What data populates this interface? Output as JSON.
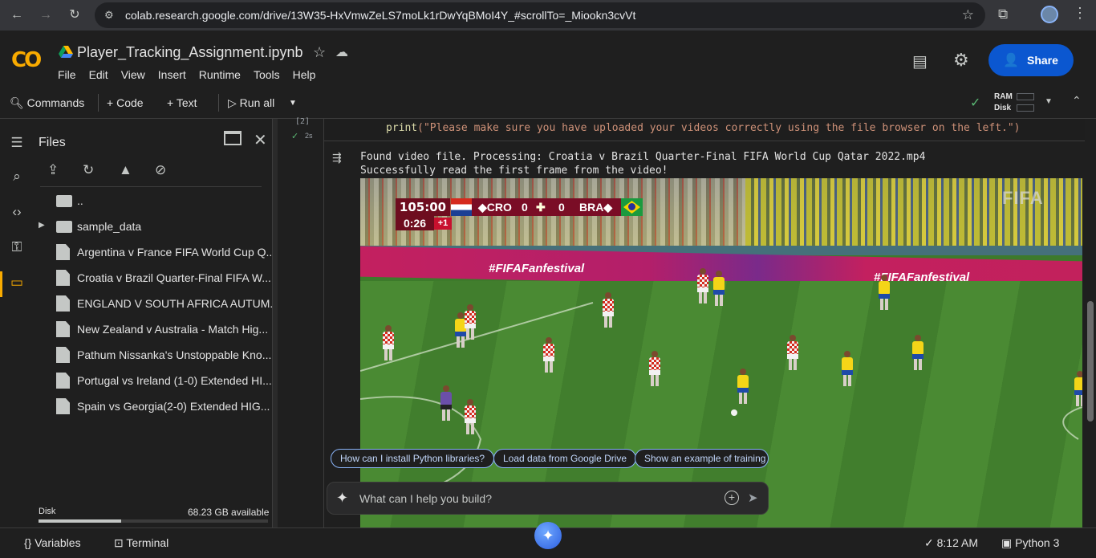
{
  "browser": {
    "url": "colab.research.google.com/drive/13W35-HxVmwZeLS7moLk1rDwYqBMoI4Y_#scrollTo=_Miookn3cvVt"
  },
  "header": {
    "logo": "CO",
    "notebook_title": "Player_Tracking_Assignment.ipynb",
    "menu": [
      "File",
      "Edit",
      "View",
      "Insert",
      "Runtime",
      "Tools",
      "Help"
    ],
    "share_label": "Share"
  },
  "toolbar": {
    "commands": "Commands",
    "code": "Code",
    "text": "Text",
    "run_all": "Run all",
    "ram_label": "RAM",
    "disk_label": "Disk"
  },
  "files_panel": {
    "title": "Files",
    "items": [
      {
        "name": "..",
        "kind": "folder"
      },
      {
        "name": "sample_data",
        "kind": "folder"
      },
      {
        "name": "Argentina v France FIFA World Cup Q...",
        "kind": "file"
      },
      {
        "name": "Croatia v Brazil Quarter-Final FIFA W...",
        "kind": "file"
      },
      {
        "name": "ENGLAND V SOUTH AFRICA AUTUM...",
        "kind": "file"
      },
      {
        "name": "New Zealand v Australia - Match Hig...",
        "kind": "file"
      },
      {
        "name": "Pathum Nissanka's Unstoppable Kno...",
        "kind": "file"
      },
      {
        "name": "Portugal vs Ireland (1-0) Extended HI...",
        "kind": "file"
      },
      {
        "name": "Spain vs Georgia(2-0) Extended HIG...",
        "kind": "file"
      }
    ],
    "disk_label": "Disk",
    "disk_available": "68.23 GB available",
    "disk_used_fraction": 0.36
  },
  "cell": {
    "exec_count": "[2]",
    "duration": "2s",
    "code_print": "print",
    "code_string": "(\"Please make sure you have uploaded your videos correctly using the file browser on the left.\")",
    "output_lines": [
      "Found video file. Processing: Croatia v Brazil  Quarter-Final  FIFA World Cup Qatar 2022.mp4",
      "Successfully read the first frame from the video!"
    ]
  },
  "video_frame": {
    "scoreboard": {
      "match_time": "105:00",
      "home": "CRO",
      "home_score": "0",
      "away_score": "0",
      "away": "BRA",
      "clock": "0:26",
      "added_time": "+1"
    },
    "ad_text": [
      "#FIFAFanfestival",
      "#FIFAFanfestival"
    ]
  },
  "gemini": {
    "suggestions": [
      "How can I install Python libraries?",
      "Load data from Google Drive",
      "Show an example of training a"
    ],
    "placeholder": "What can I help you build?"
  },
  "status_bar": {
    "variables": "Variables",
    "terminal": "Terminal",
    "time": "8:12 AM",
    "runtime": "Python 3"
  },
  "colors": {
    "accent_blue": "#0b57d0",
    "colab_orange": "#f9ab00",
    "code_string": "#ce9178",
    "code_keyword": "#dcdcaa"
  }
}
